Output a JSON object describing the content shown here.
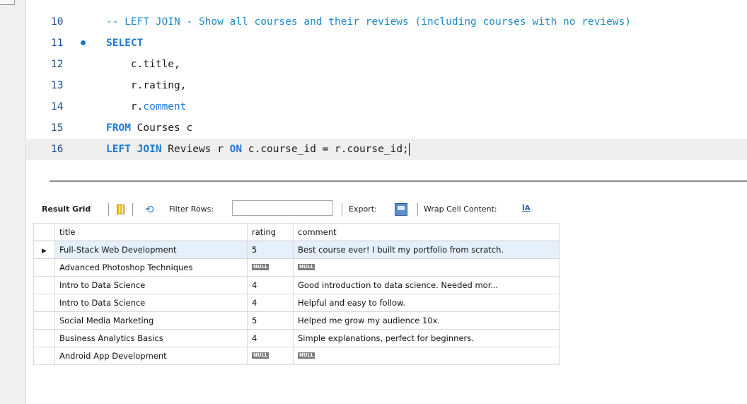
{
  "editor": {
    "lines": [
      {
        "number": "10",
        "segments": [
          {
            "text": "-- LEFT JOIN - Show all courses and their reviews (including courses with no reviews)",
            "style": "comment"
          }
        ]
      },
      {
        "number": "11",
        "marker": true,
        "segments": [
          {
            "text": "SELECT",
            "style": "kw"
          }
        ]
      },
      {
        "number": "12",
        "segments": [
          {
            "text": "    c.title,",
            "style": "plain"
          }
        ]
      },
      {
        "number": "13",
        "segments": [
          {
            "text": "    r.rating,",
            "style": "plain"
          }
        ]
      },
      {
        "number": "14",
        "segments": [
          {
            "text": "    r.",
            "style": "plain"
          },
          {
            "text": "comment",
            "style": "blue"
          }
        ]
      },
      {
        "number": "15",
        "segments": [
          {
            "text": "FROM",
            "style": "kw"
          },
          {
            "text": " Courses c",
            "style": "plain"
          }
        ]
      },
      {
        "number": "16",
        "current": true,
        "segments": [
          {
            "text": "LEFT JOIN",
            "style": "kw"
          },
          {
            "text": " Reviews r ",
            "style": "plain"
          },
          {
            "text": "ON",
            "style": "kw"
          },
          {
            "text": " c.course_id = r.course_id;",
            "style": "plain"
          }
        ]
      }
    ]
  },
  "toolbar": {
    "result_grid_label": "Result Grid",
    "filter_label": "Filter Rows:",
    "filter_value": "",
    "export_label": "Export:",
    "wrap_label": "Wrap Cell Content:",
    "wrap_icon_glyph": "ĪA",
    "icons": [
      "grid-view-icon",
      "refresh-icon",
      "export-icon",
      "wrap-cell-icon"
    ]
  },
  "grid": {
    "columns": [
      "title",
      "rating",
      "comment"
    ],
    "null_text": "NULL",
    "rows": [
      {
        "title": "Full-Stack Web Development",
        "rating": "5",
        "comment": "Best course ever! I built my portfolio from scratch.",
        "selected": true
      },
      {
        "title": "Advanced Photoshop Techniques",
        "rating": null,
        "comment": null
      },
      {
        "title": "Intro to Data Science",
        "rating": "4",
        "comment": "Good introduction to data science. Needed mor..."
      },
      {
        "title": "Intro to Data Science",
        "rating": "4",
        "comment": "Helpful and easy to follow."
      },
      {
        "title": "Social Media Marketing",
        "rating": "5",
        "comment": "Helped me grow my audience 10x."
      },
      {
        "title": "Business Analytics Basics",
        "rating": "4",
        "comment": "Simple explanations, perfect for beginners."
      },
      {
        "title": "Android App Development",
        "rating": null,
        "comment": null
      }
    ]
  },
  "colors": {
    "comment": "#1e8bc3",
    "keyword": "#1e78d2",
    "line_number": "#1a4f8a",
    "selection": "#e5f0fb"
  }
}
